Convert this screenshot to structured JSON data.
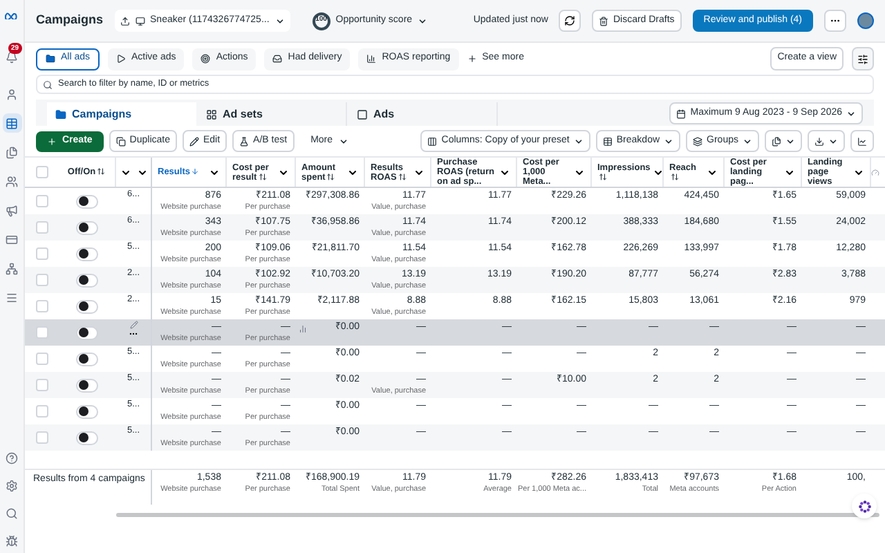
{
  "topbar": {
    "title": "Campaigns",
    "account": "Sneaker (1174326774725...",
    "opportunity_score": "100",
    "opportunity_label": "Opportunity score",
    "updated": "Updated just now",
    "discard": "Discard Drafts",
    "publish": "Review and publish (4)"
  },
  "sidebar": {
    "badge": "29",
    "items": [
      {
        "selected": false
      },
      {
        "selected": true
      },
      {
        "selected": false
      },
      {
        "selected": false
      },
      {
        "selected": false
      },
      {
        "selected": false
      },
      {
        "selected": false
      },
      {
        "selected": false
      }
    ]
  },
  "view_tabs": [
    {
      "label": "All ads",
      "selected": true
    },
    {
      "label": "Active ads",
      "selected": false
    },
    {
      "label": "Actions",
      "selected": false
    },
    {
      "label": "Had delivery",
      "selected": false
    },
    {
      "label": "ROAS reporting",
      "selected": false
    }
  ],
  "see_more": "See more",
  "create_view": "Create a view",
  "search": {
    "placeholder": "Search to filter by name, ID or metrics"
  },
  "level_tabs": [
    {
      "label": "Campaigns",
      "selected": true
    },
    {
      "label": "Ad sets",
      "selected": false
    },
    {
      "label": "Ads",
      "selected": false
    }
  ],
  "date_range": "Maximum 9 Aug 2023 - 9 Sep 2026",
  "toolbar": {
    "create": "Create",
    "duplicate": "Duplicate",
    "edit": "Edit",
    "ab_test": "A/B test",
    "more": "More",
    "columns": "Columns: Copy of your preset",
    "breakdown": "Breakdow",
    "groups": "Groups"
  },
  "table": {
    "select_all_checked": false,
    "toggle_column": {
      "label": "Off/On",
      "sortable": true
    },
    "columns": [
      {
        "label": "Results",
        "sortable": true,
        "selected": true
      },
      {
        "label": "Cost per result",
        "sortable": true,
        "selected": false
      },
      {
        "label": "Amount spent",
        "sortable": true,
        "selected": false
      },
      {
        "label": "Results ROAS",
        "sortable": true,
        "selected": false
      },
      {
        "label": "Purchase ROAS (return on ad sp...",
        "sortable": false,
        "selected": false
      },
      {
        "label": "Cost per 1,000 Meta...",
        "sortable": false,
        "selected": false
      },
      {
        "label": "Impressions",
        "sortable": true,
        "selected": false
      },
      {
        "label": "Reach",
        "sortable": true,
        "selected": false
      },
      {
        "label": "Cost per landing pag...",
        "sortable": false,
        "selected": false
      },
      {
        "label": "Landing page views",
        "sortable": false,
        "selected": false
      }
    ],
    "rows": [
      {
        "name": "6...",
        "checked": false,
        "on": false,
        "hover": false,
        "cells": [
          {
            "value": "876",
            "sub": "Website purchase"
          },
          {
            "value": "₹211.08",
            "sub": "Per purchase"
          },
          {
            "value": "₹297,308.86"
          },
          {
            "value": "11.77",
            "sub": "Value, purchase"
          },
          {
            "value": "11.77"
          },
          {
            "value": "₹229.26"
          },
          {
            "value": "1,118,138"
          },
          {
            "value": "424,450"
          },
          {
            "value": "₹1.65"
          },
          {
            "value": "59,009"
          }
        ]
      },
      {
        "name": "6...",
        "checked": false,
        "on": false,
        "hover": false,
        "cells": [
          {
            "value": "343",
            "sub": "Website purchase"
          },
          {
            "value": "₹107.75",
            "sub": "Per purchase"
          },
          {
            "value": "₹36,958.86"
          },
          {
            "value": "11.74",
            "sub": "Value, purchase"
          },
          {
            "value": "11.74"
          },
          {
            "value": "₹200.12"
          },
          {
            "value": "388,333"
          },
          {
            "value": "184,680"
          },
          {
            "value": "₹1.55"
          },
          {
            "value": "24,002"
          }
        ]
      },
      {
        "name": "5...",
        "checked": false,
        "on": false,
        "hover": false,
        "cells": [
          {
            "value": "200",
            "sub": "Website purchase"
          },
          {
            "value": "₹109.06",
            "sub": "Per purchase"
          },
          {
            "value": "₹21,811.70"
          },
          {
            "value": "11.54",
            "sub": "Value, purchase"
          },
          {
            "value": "11.54"
          },
          {
            "value": "₹162.78"
          },
          {
            "value": "226,269"
          },
          {
            "value": "133,997"
          },
          {
            "value": "₹1.78"
          },
          {
            "value": "12,280"
          }
        ]
      },
      {
        "name": "2...",
        "checked": false,
        "on": false,
        "hover": false,
        "cells": [
          {
            "value": "104",
            "sub": "Website purchase"
          },
          {
            "value": "₹102.92",
            "sub": "Per purchase"
          },
          {
            "value": "₹10,703.20"
          },
          {
            "value": "13.19",
            "sub": "Value, purchase"
          },
          {
            "value": "13.19"
          },
          {
            "value": "₹190.20"
          },
          {
            "value": "87,777"
          },
          {
            "value": "56,274"
          },
          {
            "value": "₹2.83"
          },
          {
            "value": "3,788"
          }
        ]
      },
      {
        "name": "2...",
        "checked": false,
        "on": false,
        "hover": false,
        "cells": [
          {
            "value": "15",
            "sub": "Website purchase"
          },
          {
            "value": "₹141.79",
            "sub": "Per purchase"
          },
          {
            "value": "₹2,117.88"
          },
          {
            "value": "8.88",
            "sub": "Value, purchase"
          },
          {
            "value": "8.88"
          },
          {
            "value": "₹162.15"
          },
          {
            "value": "15,803"
          },
          {
            "value": "13,061"
          },
          {
            "value": "₹2.16"
          },
          {
            "value": "979"
          }
        ]
      },
      {
        "checked": false,
        "on": false,
        "hover": true,
        "cells": [
          {
            "value": "—",
            "sub": "Website purchase"
          },
          {
            "value": "—",
            "sub": "Per purchase"
          },
          {
            "value": "₹0.00"
          },
          {
            "value": "—"
          },
          {
            "value": "—"
          },
          {
            "value": "—"
          },
          {
            "value": "—"
          },
          {
            "value": "—"
          },
          {
            "value": "—"
          },
          {
            "value": "—"
          }
        ]
      },
      {
        "name": "5...",
        "checked": false,
        "on": false,
        "hover": false,
        "cells": [
          {
            "value": "—",
            "sub": "Website purchase"
          },
          {
            "value": "—",
            "sub": "Per purchase"
          },
          {
            "value": "₹0.00"
          },
          {
            "value": "—"
          },
          {
            "value": "—"
          },
          {
            "value": "—"
          },
          {
            "value": "2"
          },
          {
            "value": "2"
          },
          {
            "value": "—"
          },
          {
            "value": "—"
          }
        ]
      },
      {
        "name": "5...",
        "checked": false,
        "on": false,
        "hover": false,
        "cells": [
          {
            "value": "—",
            "sub": "Website purchase"
          },
          {
            "value": "—",
            "sub": "Per purchase"
          },
          {
            "value": "₹0.02"
          },
          {
            "value": "—",
            "sub": "Value, purchase"
          },
          {
            "value": "—"
          },
          {
            "value": "₹10.00"
          },
          {
            "value": "2"
          },
          {
            "value": "2"
          },
          {
            "value": "—"
          },
          {
            "value": "—"
          }
        ]
      },
      {
        "name": "5...",
        "checked": false,
        "on": false,
        "hover": false,
        "cells": [
          {
            "value": "—",
            "sub": "Website purchase"
          },
          {
            "value": "—",
            "sub": "Per purchase"
          },
          {
            "value": "₹0.00"
          },
          {
            "value": "—"
          },
          {
            "value": "—"
          },
          {
            "value": "—"
          },
          {
            "value": "—"
          },
          {
            "value": "—"
          },
          {
            "value": "—"
          },
          {
            "value": "—"
          }
        ]
      },
      {
        "name": "5...",
        "checked": false,
        "on": false,
        "hover": false,
        "cells": [
          {
            "value": "—",
            "sub": "Website purchase"
          },
          {
            "value": "—",
            "sub": "Per purchase"
          },
          {
            "value": "₹0.00"
          },
          {
            "value": "—"
          },
          {
            "value": "—"
          },
          {
            "value": "—"
          },
          {
            "value": "—"
          },
          {
            "value": "—"
          },
          {
            "value": "—"
          },
          {
            "value": "—"
          }
        ]
      }
    ],
    "summary": {
      "label": "Results from 4 campaigns",
      "cells": [
        {
          "value": "1,538",
          "sub": "Website purchase"
        },
        {
          "value": "₹211.08",
          "sub": "Per purchase"
        },
        {
          "value": "₹168,900.19",
          "sub": "Total Spent"
        },
        {
          "value": "11.79",
          "sub": "Value, purchase"
        },
        {
          "value": "11.79",
          "sub": "Average"
        },
        {
          "value": "₹282.26",
          "sub": "Per 1,000 Meta ac..."
        },
        {
          "value": "1,833,413",
          "sub": "Total"
        },
        {
          "value": "₹97,673",
          "sub": "Meta accounts"
        },
        {
          "value": "₹1.68",
          "sub": "Per Action"
        },
        {
          "value": "100,"
        }
      ]
    }
  }
}
